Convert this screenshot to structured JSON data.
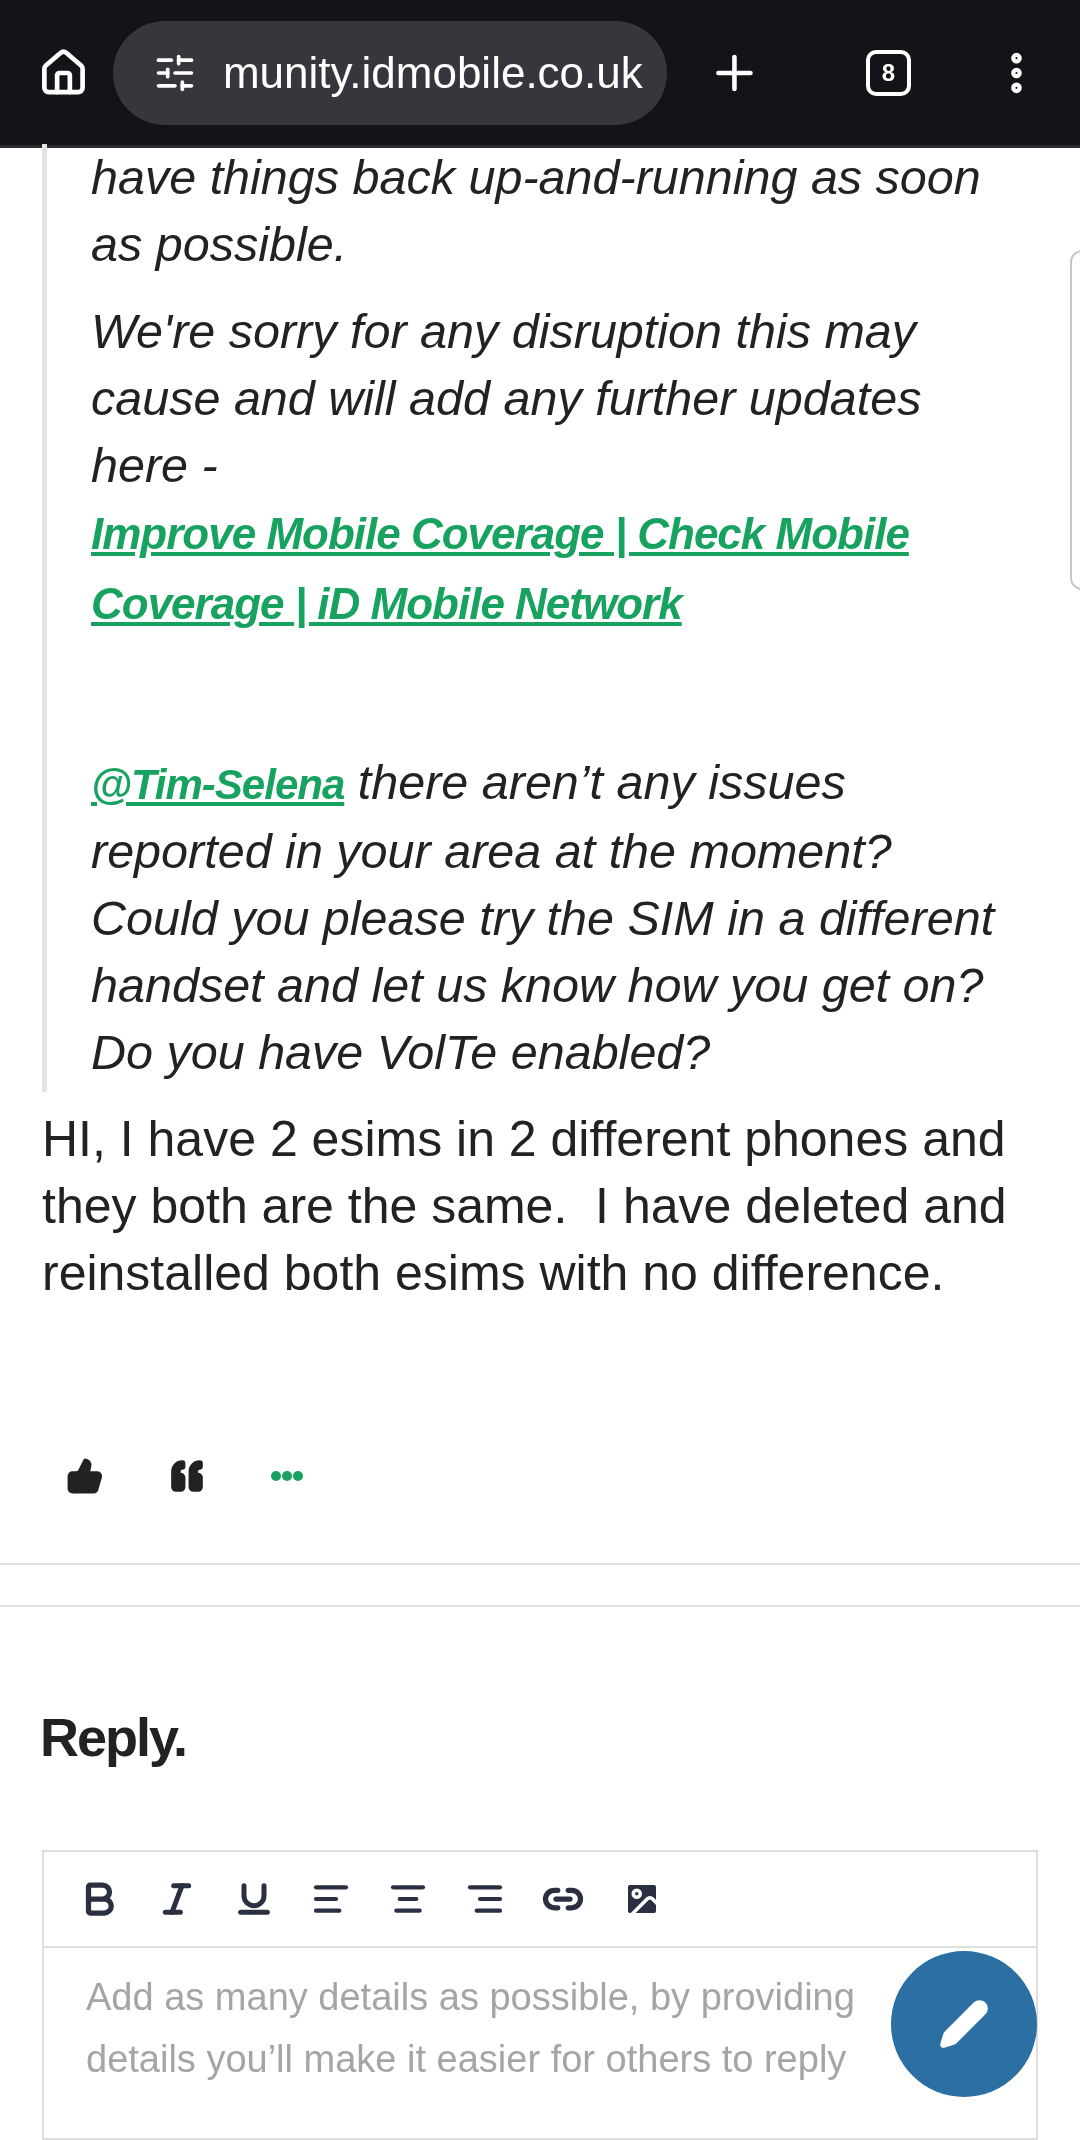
{
  "browser": {
    "url": "munity.idmobile.co.uk",
    "tab_count": "8"
  },
  "quote": {
    "paragraphs": [
      {
        "text": "have things back up-and-running as soon as possible."
      },
      {
        "text": "We're sorry for any disruption this may cause and will add any further updates here - ",
        "link": "Improve Mobile Coverage | Check Mobile Coverage | iD Mobile Network"
      }
    ],
    "mention": {
      "handle": "@Tim-Selena",
      "text": " there aren’t any issues reported in your area at the moment? Could you please try the SIM in a different handset and let us know how you get on? Do you have VolTe enabled?"
    }
  },
  "post_body": "HI, I have 2 esims in 2 different phones and they both are the same.  I have deleted and reinstalled both esims with no difference.",
  "reply": {
    "heading": "Reply.",
    "placeholder": "Add as many details as possible, by providing details you’ll make it easier for others to reply"
  }
}
